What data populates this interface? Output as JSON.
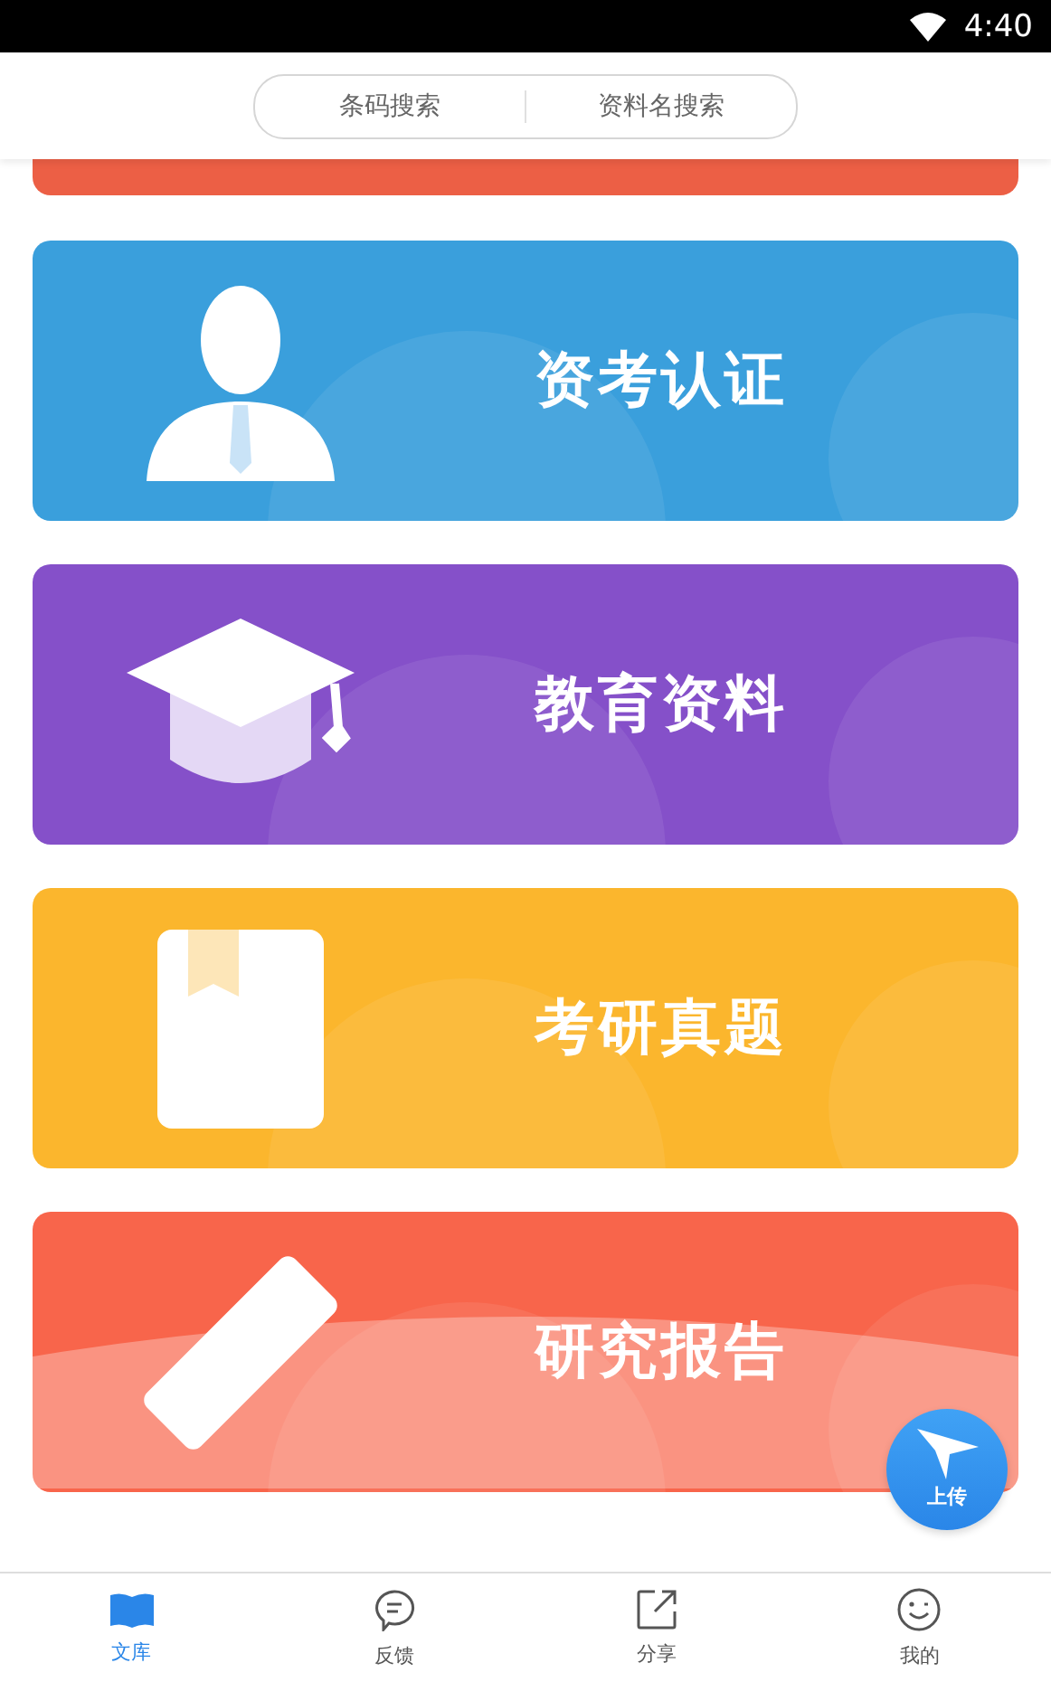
{
  "status_bar": {
    "time": "4:40"
  },
  "search_tabs": [
    {
      "label": "条码搜索",
      "selected": false
    },
    {
      "label": "资料名搜索",
      "selected": false
    }
  ],
  "cards": [
    {
      "kind": "partial",
      "color": "#ec5f45"
    },
    {
      "kind": "person",
      "label": "资考认证",
      "color": "#3a9fdc"
    },
    {
      "kind": "cap",
      "label": "教育资料",
      "color": "#8550c9"
    },
    {
      "kind": "book",
      "label": "考研真题",
      "color": "#fbb62d"
    },
    {
      "kind": "pencil",
      "label": "研究报告",
      "color": "#f8654b"
    }
  ],
  "upload_button": {
    "label": "上传"
  },
  "nav": [
    {
      "kind": "library",
      "label": "文库",
      "selected": true
    },
    {
      "kind": "feedback",
      "label": "反馈",
      "selected": false
    },
    {
      "kind": "share",
      "label": "分享",
      "selected": false
    },
    {
      "kind": "profile",
      "label": "我的",
      "selected": false
    }
  ]
}
